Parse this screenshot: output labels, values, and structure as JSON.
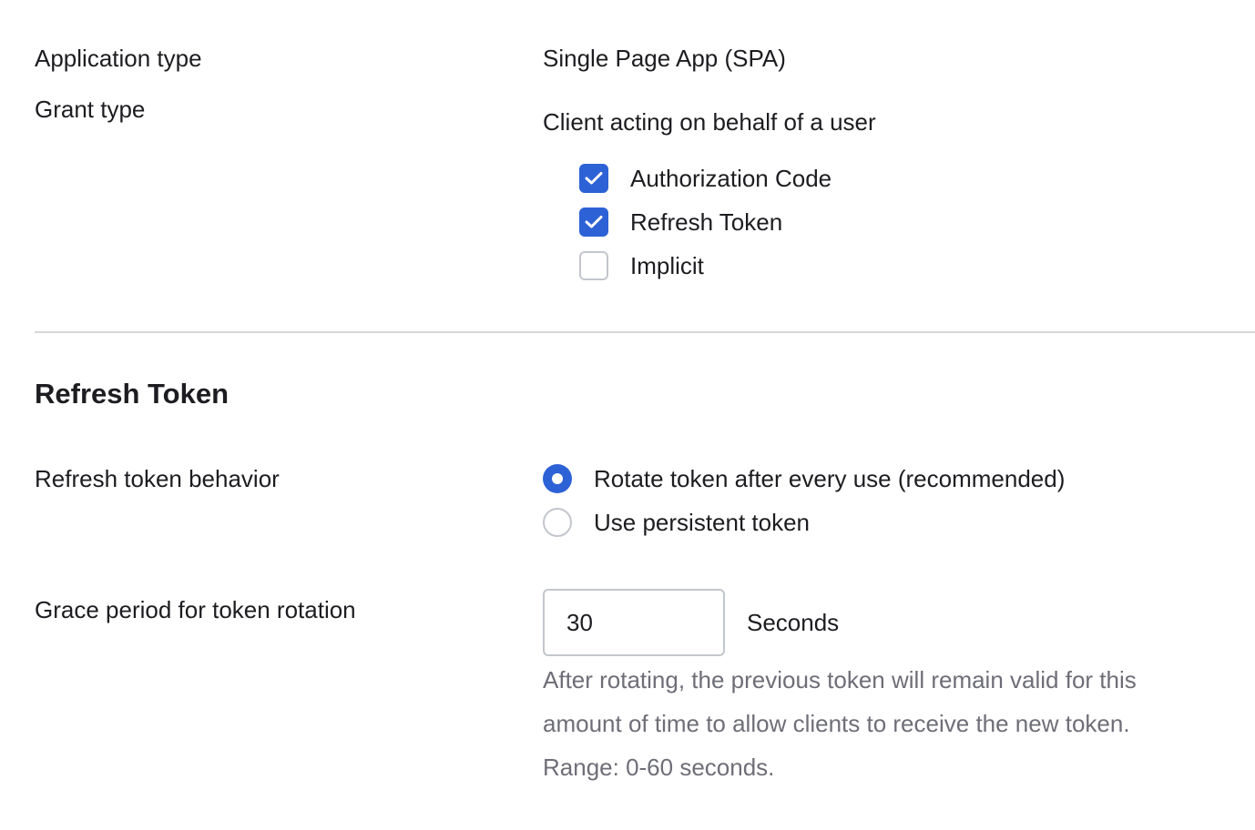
{
  "app": {
    "application_type": {
      "label": "Application type",
      "value": "Single Page App (SPA)"
    },
    "grant_type": {
      "label": "Grant type",
      "subheading": "Client acting on behalf of a user",
      "options": [
        {
          "label": "Authorization Code",
          "checked": true
        },
        {
          "label": "Refresh Token",
          "checked": true
        },
        {
          "label": "Implicit",
          "checked": false
        }
      ]
    }
  },
  "refresh_token": {
    "section_title": "Refresh Token",
    "behavior": {
      "label": "Refresh token behavior",
      "options": [
        {
          "label": "Rotate token after every use (recommended)",
          "selected": true
        },
        {
          "label": "Use persistent token",
          "selected": false
        }
      ]
    },
    "grace_period": {
      "label": "Grace period for token rotation",
      "value": "30",
      "unit": "Seconds",
      "help_line1": "After rotating, the previous token will remain valid for this",
      "help_line2": "amount of time to allow clients to receive the new token.",
      "help_line3": "Range: 0-60 seconds."
    }
  },
  "colors": {
    "accent": "#2d62d6",
    "text": "#1d1d21",
    "muted": "#6e6e78",
    "border": "#c3c6cc",
    "divider": "#d6d7da"
  },
  "icons": {
    "checked": "checkmark-icon"
  }
}
